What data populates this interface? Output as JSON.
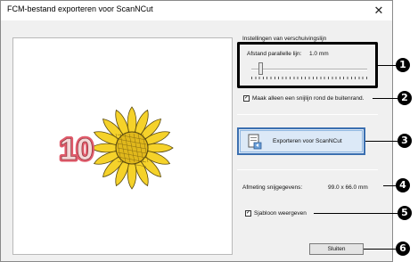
{
  "window": {
    "title": "FCM-bestand exporteren voor ScanNCut",
    "close_glyph": "✕"
  },
  "settings": {
    "group_title": "Instellingen van verschuivingslijn",
    "distance_label": "Afstand parallelle lijn:",
    "distance_value": "1.0 mm",
    "slider_fraction": 0.06
  },
  "options": {
    "inner_line_label": "Maak alleen een snijlijn rond de buitenrand.",
    "inner_line_checked": true,
    "template_label": "Sjabloon weergeven",
    "template_checked": true
  },
  "export_button": {
    "label": "Exporteren voor ScanNCut",
    "icon": "export-file-icon"
  },
  "cut_size": {
    "label": "Afmeting snijgegevens:",
    "value": "99.0 x 66.0 mm"
  },
  "close_button": {
    "label": "Sluiten"
  },
  "preview": {
    "number_text": "10",
    "flower_color": "#f5d22a",
    "center_color": "#e0b81c",
    "number_color": "#e05a6a"
  },
  "callouts": [
    "1",
    "2",
    "3",
    "4",
    "5",
    "6"
  ]
}
